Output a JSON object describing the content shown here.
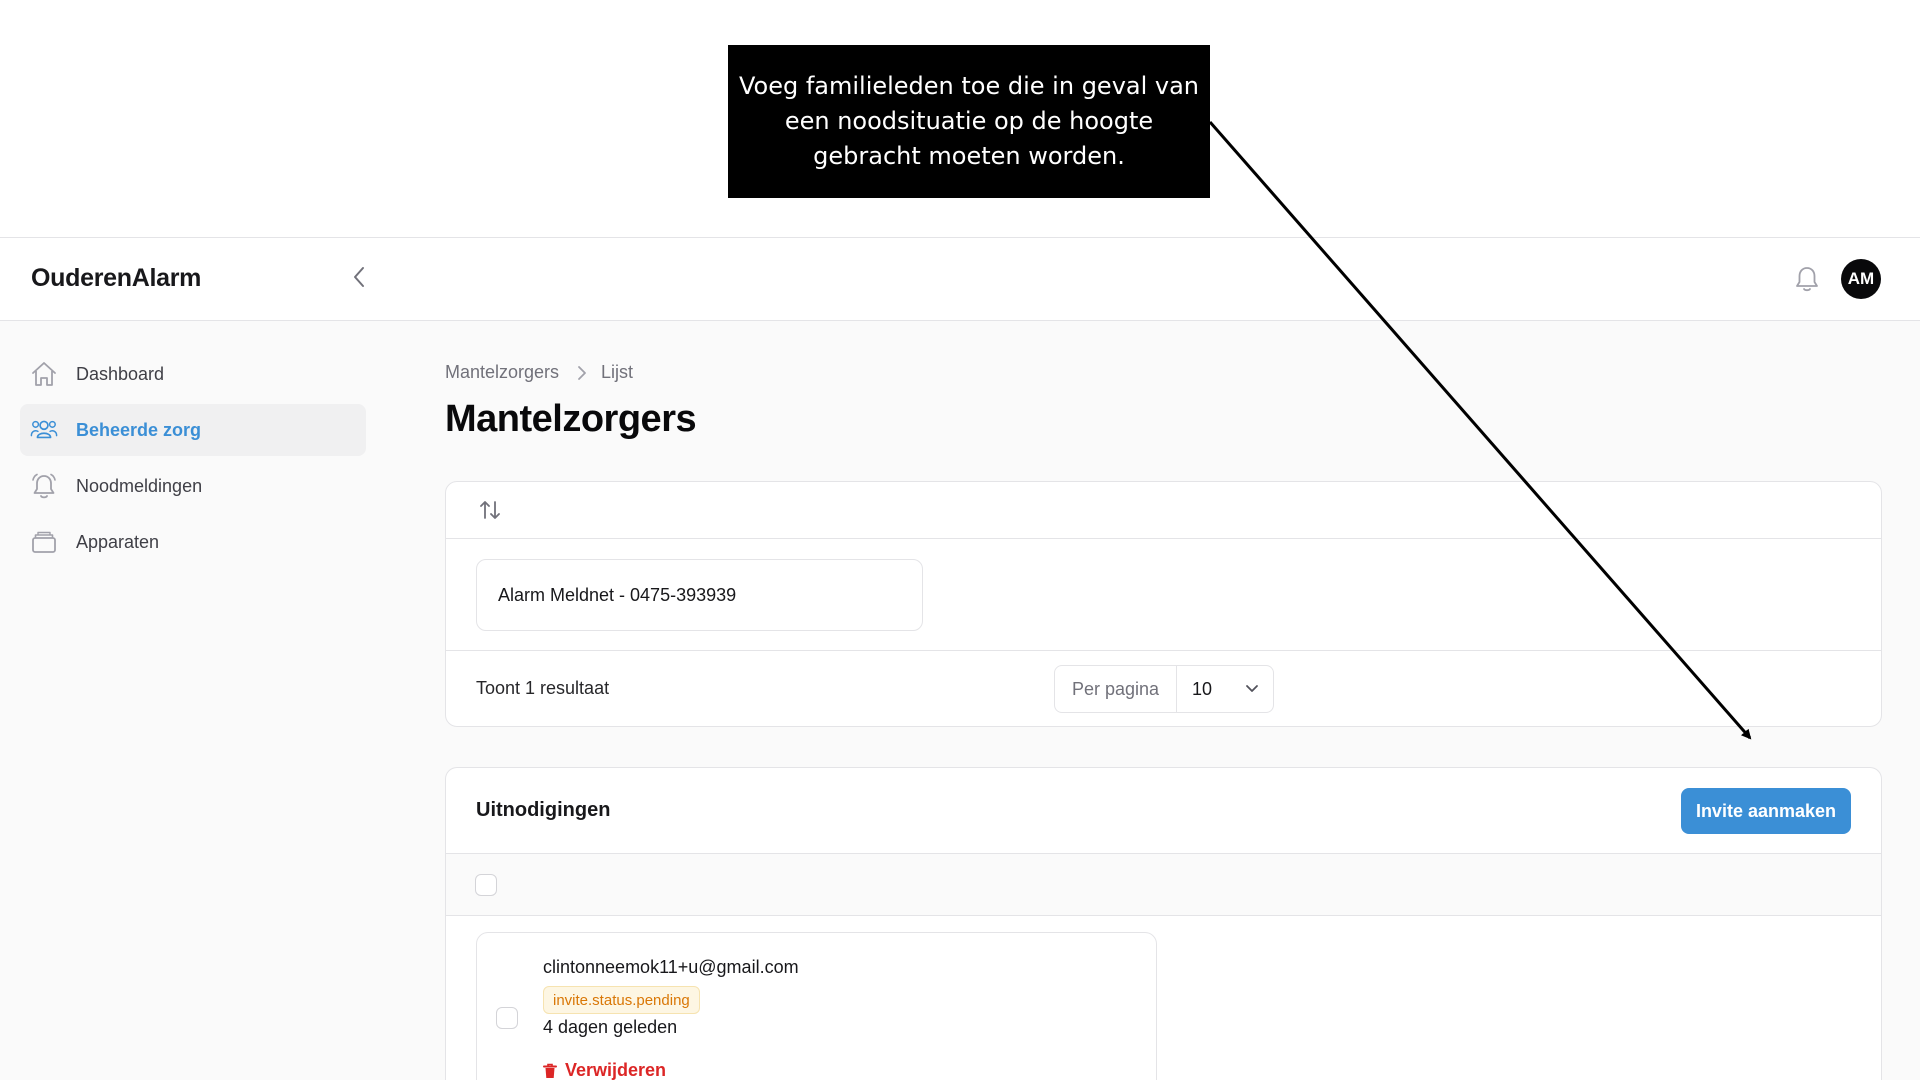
{
  "annotation": {
    "text": "Voeg familieleden toe die in geval van een noodsituatie op de hoogte gebracht moeten worden."
  },
  "header": {
    "brand": "OuderenAlarm",
    "avatar_initials": "AM"
  },
  "sidebar": {
    "items": [
      {
        "label": "Dashboard",
        "icon": "home-icon",
        "active": false
      },
      {
        "label": "Beheerde zorg",
        "icon": "users-icon",
        "active": true
      },
      {
        "label": "Noodmeldingen",
        "icon": "bell-alert-icon",
        "active": false
      },
      {
        "label": "Apparaten",
        "icon": "device-icon",
        "active": false
      }
    ]
  },
  "main": {
    "breadcrumb": [
      "Mantelzorgers",
      "Lijst"
    ],
    "title": "Mantelzorgers",
    "records": [
      {
        "label": "Alarm Meldnet - 0475-393939"
      }
    ],
    "results_text": "Toont 1 resultaat",
    "per_page": {
      "label": "Per pagina",
      "value": "10"
    }
  },
  "invitations": {
    "title": "Uitnodigingen",
    "create_button": "Invite aanmaken",
    "items": [
      {
        "email": "clintonneemok11+u@gmail.com",
        "status": "invite.status.pending",
        "time": "4 dagen geleden",
        "delete_label": "Verwijderen"
      }
    ]
  },
  "colors": {
    "accent": "#3b8fd6",
    "danger": "#dc2626",
    "pending": "#d97706"
  }
}
